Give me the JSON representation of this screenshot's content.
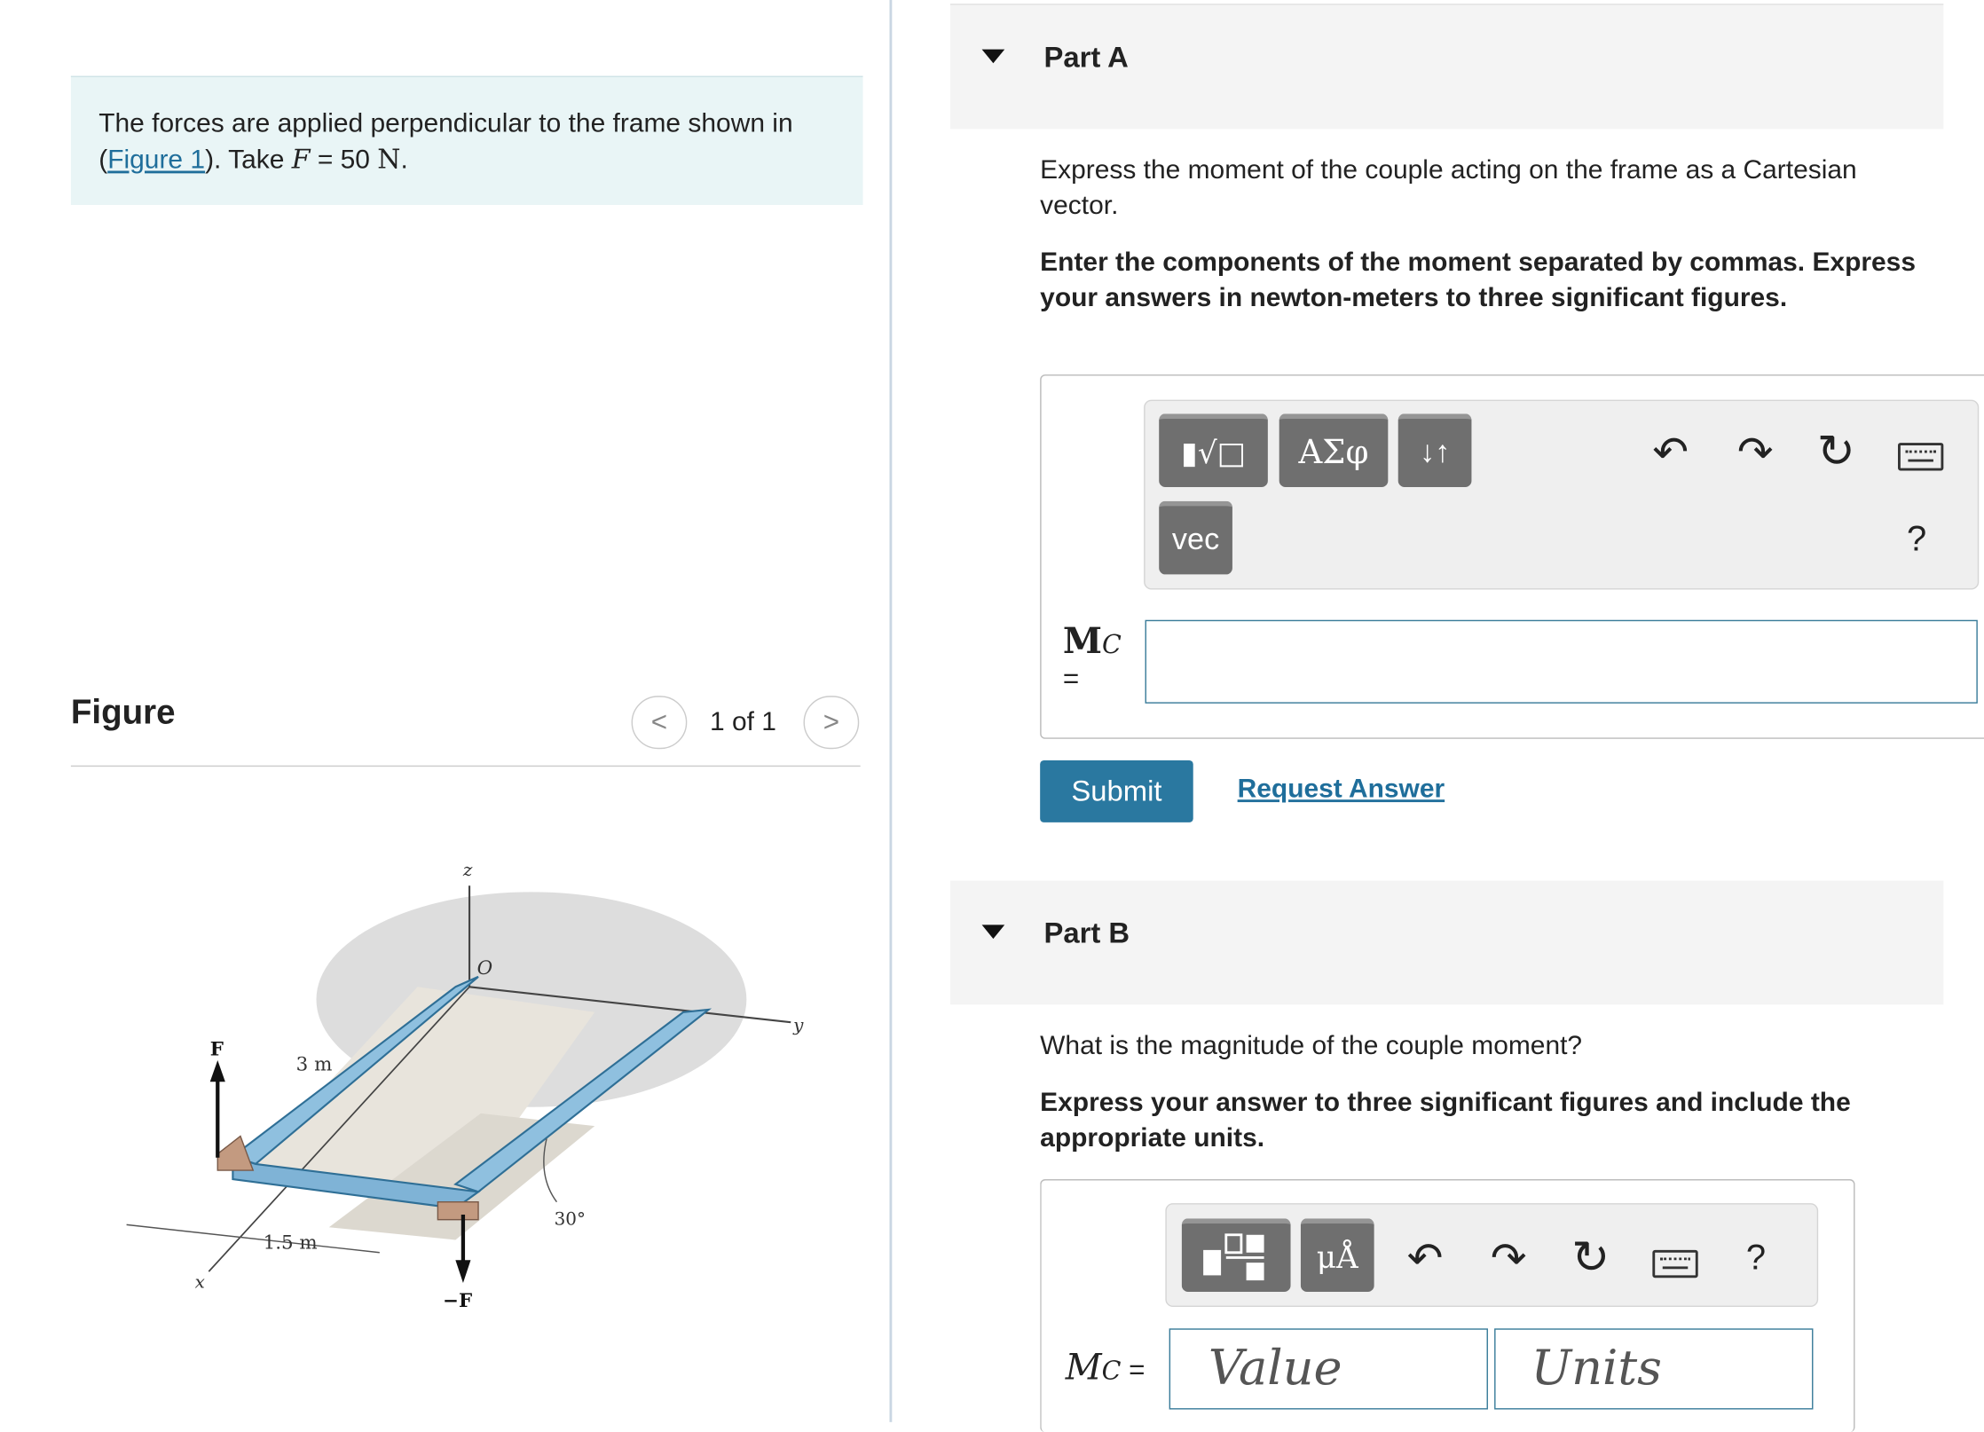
{
  "problem": {
    "text_before": "The forces are applied perpendicular to the frame shown in (",
    "figure_link": "Figure 1",
    "text_mid": "). Take ",
    "var": "F",
    "eq": " = 50 ",
    "unit": "N",
    "text_after": "."
  },
  "figure": {
    "title": "Figure",
    "counter": "1 of 1",
    "labels": {
      "z": "z",
      "o": "O",
      "y": "y",
      "x": "x",
      "f": "F",
      "neg_f": "−F",
      "dim_3m": "3 m",
      "dim_15m": "1.5 m",
      "angle": "30°"
    }
  },
  "part_a": {
    "title": "Part A",
    "question": "Express the moment of the couple acting on the frame as a Cartesian vector.",
    "instructions": "Enter the components of the moment separated by commas. Express your answers in newton-meters to three significant figures.",
    "toolbar": {
      "templates_label": "▮√□",
      "greek_label": "ΑΣφ",
      "sort_label": "↓↑",
      "vec_label": "vec",
      "help_label": "?"
    },
    "variable_main": "M",
    "variable_sub": "C",
    "equals": "=",
    "submit": "Submit",
    "request": "Request Answer"
  },
  "part_b": {
    "title": "Part B",
    "question": "What is the magnitude of the couple moment?",
    "instructions": "Express your answer to three significant figures and include the appropriate units.",
    "toolbar": {
      "units_label": "μÅ",
      "help_label": "?"
    },
    "variable_main": "M",
    "variable_sub": "C",
    "equals": " =",
    "value_placeholder": "Value",
    "units_placeholder": "Units"
  }
}
